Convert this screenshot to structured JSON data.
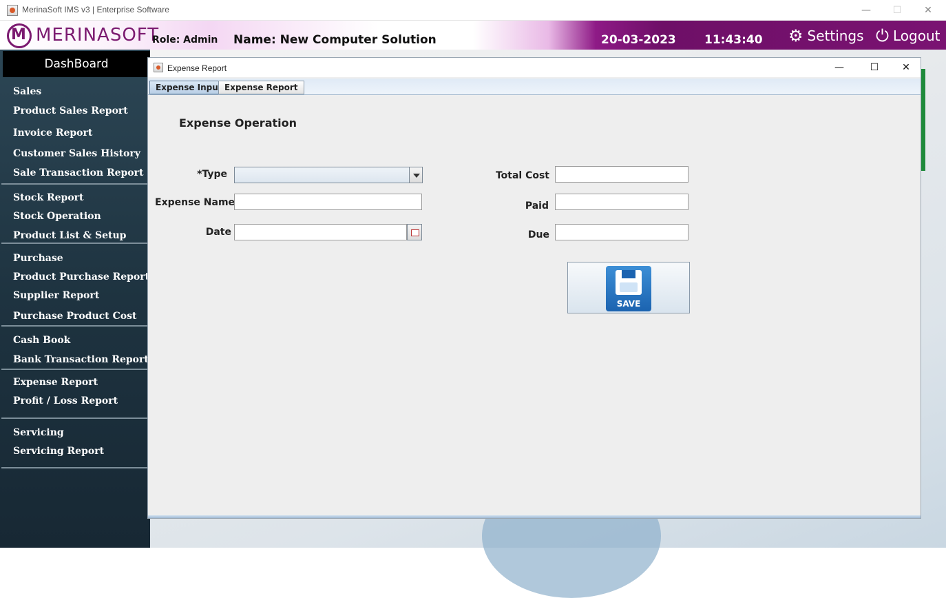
{
  "window": {
    "title": "MerinaSoft IMS v3 | Enterprise Software",
    "minimize": "—",
    "maximize": "☐",
    "close": "✕"
  },
  "header": {
    "brand": "MERINASOFT",
    "role": "Role: Admin",
    "name": "Name: New Computer Solution",
    "date": "20-03-2023",
    "time": "11:43:40",
    "settings_label": "Settings",
    "logout_label": "Logout"
  },
  "sidebar": {
    "dashboard_label": "DashBoard",
    "items": [
      "Sales",
      "Product Sales Report",
      "Invoice Report",
      "Customer Sales History",
      "Sale Transaction Report",
      "Stock Report",
      "Stock Operation",
      "Product List & Setup",
      "Purchase",
      "Product Purchase Report",
      "Supplier Report",
      "Purchase Product Cost",
      "Cash Book",
      "Bank Transaction Report",
      "Expense Report",
      "Profit / Loss Report",
      "Servicing",
      "Servicing Report"
    ]
  },
  "dialog": {
    "title": "Expense Report",
    "minimize": "—",
    "maximize": "☐",
    "close": "✕",
    "tabs": [
      "Expense Input",
      "Expense Report"
    ],
    "active_tab": "Expense Input",
    "section_title": "Expense Operation",
    "fields": {
      "type_label": "*Type",
      "type_value": "",
      "expense_name_label": "Expense Name",
      "expense_name_value": "",
      "date_label": "Date",
      "date_value": "",
      "total_cost_label": "Total Cost",
      "total_cost_value": "",
      "paid_label": "Paid",
      "paid_value": "",
      "due_label": "Due",
      "due_value": ""
    },
    "save_label": "SAVE"
  },
  "colors": {
    "sidebar_bg": "#1e3340",
    "header_accent": "#7a1372",
    "brand": "#7b1a70",
    "tab_active": "#b9cfe6",
    "save_icon": "#1b63b0"
  },
  "icons": {
    "app": "app-icon",
    "settings": "gear-icon",
    "logout": "power-icon",
    "dropdown": "chevron-down-icon",
    "calendar": "calendar-icon",
    "save": "floppy-disk-icon"
  }
}
